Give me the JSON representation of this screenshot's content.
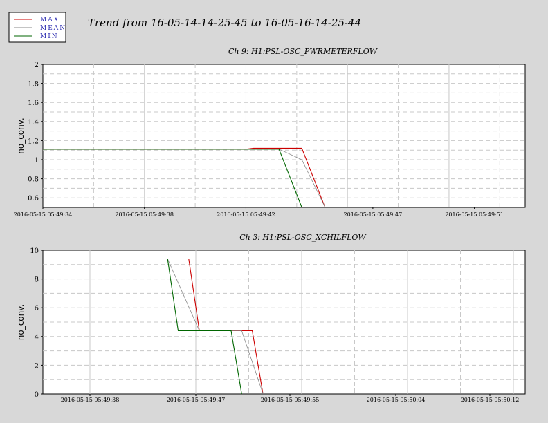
{
  "title": "Trend from 16-05-14-14-25-45 to 16-05-16-14-25-44",
  "legend": [
    {
      "label": "MAX",
      "color": "#cc0000"
    },
    {
      "label": "MEAN",
      "color": "#888888"
    },
    {
      "label": "MIN",
      "color": "#006600"
    }
  ],
  "chart_data": [
    {
      "type": "line",
      "title": "Ch 9: H1:PSL-OSC_PWRMETERFLOW",
      "xlabel": "",
      "ylabel": "no_conv.",
      "xlim": [
        "2016-05-15 05:49:34",
        "2016-05-15 05:49:53"
      ],
      "ylim": [
        0.5,
        2.0
      ],
      "yticks": [
        0.6,
        0.8,
        1,
        1.2,
        1.4,
        1.6,
        1.8,
        2
      ],
      "ytick_labels": [
        "0.6",
        "0.8",
        "1",
        "1.2",
        "1.4",
        "1.6",
        "1.8",
        "2"
      ],
      "xticks": [
        "2016-05-15 05:49:34",
        "2016-05-15 05:49:38",
        "2016-05-15 05:49:42",
        "2016-05-15 05:49:47",
        "2016-05-15 05:49:51"
      ],
      "xtick_labels": [
        "2016-05-15 05:49:34",
        "2016-05-15 05:49:38",
        "2016-05-15 05:49:42",
        "2016-05-15 05:49:47",
        "2016-05-15 05:49:51"
      ],
      "grid": true,
      "series": [
        {
          "name": "MAX",
          "color": "#cc0000",
          "x": [
            "2016-05-15 05:49:34",
            "2016-05-15 05:49:42",
            "2016-05-15 05:49:42.3",
            "2016-05-15 05:49:44.2",
            "2016-05-15 05:49:45.1"
          ],
          "y": [
            1.11,
            1.11,
            1.12,
            1.12,
            0.51
          ]
        },
        {
          "name": "MEAN",
          "color": "#888888",
          "x": [
            "2016-05-15 05:49:34",
            "2016-05-15 05:49:43.3",
            "2016-05-15 05:49:44.2",
            "2016-05-15 05:49:45.1"
          ],
          "y": [
            1.11,
            1.11,
            1.0,
            0.51
          ]
        },
        {
          "name": "MIN",
          "color": "#006600",
          "x": [
            "2016-05-15 05:49:34",
            "2016-05-15 05:49:43.3",
            "2016-05-15 05:49:44.2"
          ],
          "y": [
            1.11,
            1.11,
            0.5
          ]
        }
      ]
    },
    {
      "type": "line",
      "title": "Ch 3: H1:PSL-OSC_XCHILFLOW",
      "xlabel": "",
      "ylabel": "no_conv.",
      "xlim": [
        "2016-05-15 05:49:34",
        "2016-05-15 05:50:15"
      ],
      "ylim": [
        0,
        10
      ],
      "yticks": [
        0,
        2,
        4,
        6,
        8,
        10
      ],
      "ytick_labels": [
        "0",
        "2",
        "4",
        "6",
        "8",
        "10"
      ],
      "xticks": [
        "2016-05-15 05:49:38",
        "2016-05-15 05:49:47",
        "2016-05-15 05:49:55",
        "2016-05-15 05:50:04",
        "2016-05-15 05:50:12"
      ],
      "xtick_labels": [
        "2016-05-15 05:49:38",
        "2016-05-15 05:49:47",
        "2016-05-15 05:49:55",
        "2016-05-15 05:50:04",
        "2016-05-15 05:50:12"
      ],
      "grid": true,
      "series": [
        {
          "name": "MAX",
          "color": "#cc0000",
          "x": [
            "2016-05-15 05:49:34",
            "2016-05-15 05:49:45.5",
            "2016-05-15 05:49:46.4",
            "2016-05-15 05:49:47.3",
            "2016-05-15 05:49:50.9",
            "2016-05-15 05:49:51.8",
            "2016-05-15 05:49:52.7"
          ],
          "y": [
            9.4,
            9.4,
            9.4,
            4.4,
            4.4,
            4.4,
            0.05
          ]
        },
        {
          "name": "MEAN",
          "color": "#888888",
          "x": [
            "2016-05-15 05:49:34",
            "2016-05-15 05:49:44.6",
            "2016-05-15 05:49:47.3",
            "2016-05-15 05:49:50.9",
            "2016-05-15 05:49:52.7"
          ],
          "y": [
            9.4,
            9.4,
            4.4,
            4.4,
            0.05
          ]
        },
        {
          "name": "MIN",
          "color": "#006600",
          "x": [
            "2016-05-15 05:49:34",
            "2016-05-15 05:49:44.6",
            "2016-05-15 05:49:45.5",
            "2016-05-15 05:49:50.0",
            "2016-05-15 05:49:50.9"
          ],
          "y": [
            9.4,
            9.4,
            4.4,
            4.4,
            0
          ]
        }
      ]
    }
  ]
}
